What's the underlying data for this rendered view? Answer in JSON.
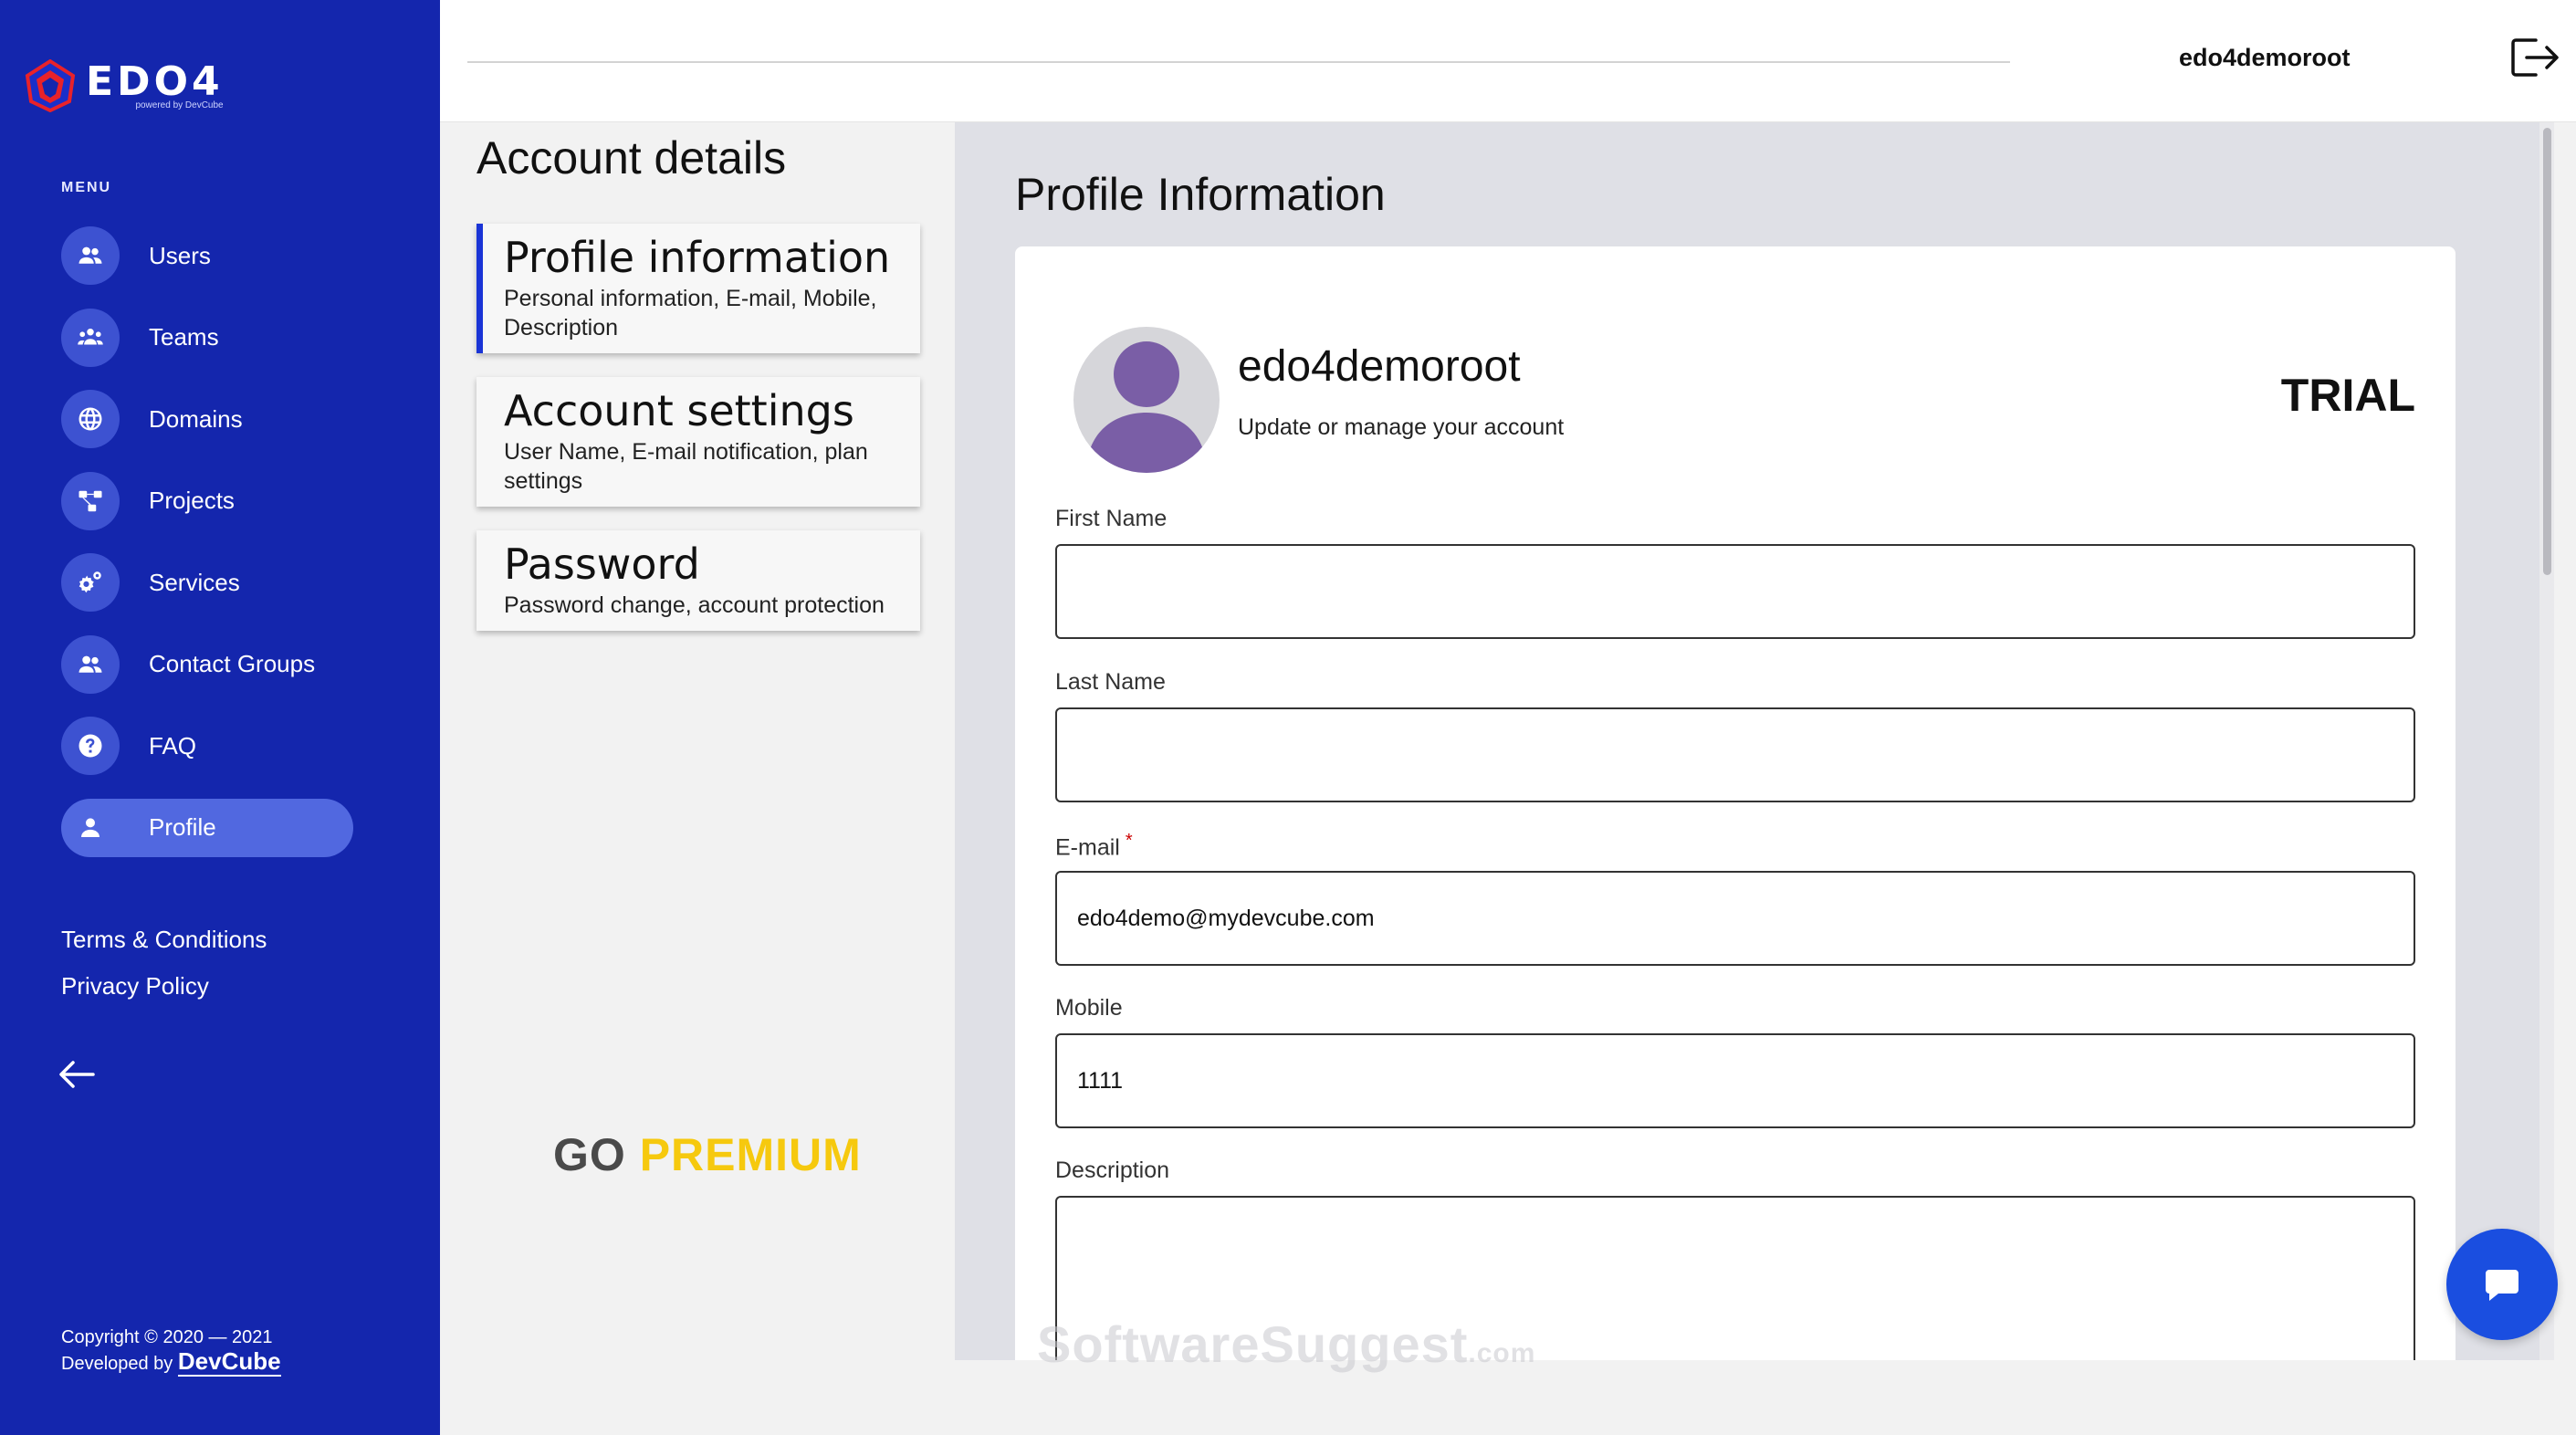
{
  "app": {
    "logo_text": "EDO4",
    "logo_subtitle": "powered by DevCube"
  },
  "sidebar": {
    "menu_label": "MENU",
    "items": [
      {
        "label": "Users",
        "icon": "users-icon"
      },
      {
        "label": "Teams",
        "icon": "teams-icon"
      },
      {
        "label": "Domains",
        "icon": "globe-icon"
      },
      {
        "label": "Projects",
        "icon": "projects-icon"
      },
      {
        "label": "Services",
        "icon": "gears-icon"
      },
      {
        "label": "Contact Groups",
        "icon": "contact-groups-icon"
      },
      {
        "label": "FAQ",
        "icon": "question-icon"
      },
      {
        "label": "Profile",
        "icon": "user-icon",
        "active": true
      }
    ],
    "links": {
      "terms": "Terms & Conditions",
      "privacy": "Privacy Policy"
    },
    "copyright": "Copyright © 2020 — 2021",
    "developed_by": "Developed by",
    "developer": "DevCube"
  },
  "topbar": {
    "username": "edo4demoroot"
  },
  "account": {
    "title": "Account details",
    "cards": [
      {
        "title": "Profile information",
        "desc": "Personal information, E-mail, Mobile, Description",
        "active": true
      },
      {
        "title": "Account settings",
        "desc": "User Name, E-mail notification, plan settings"
      },
      {
        "title": "Password",
        "desc": "Password change, account protection"
      }
    ],
    "go_premium": {
      "go": "GO",
      "premium": "PREMIUM"
    }
  },
  "profile": {
    "section_title": "Profile Information",
    "name": "edo4demoroot",
    "subtitle": "Update or manage your account",
    "plan": "TRIAL",
    "fields": {
      "first_name": {
        "label": "First Name",
        "value": ""
      },
      "last_name": {
        "label": "Last Name",
        "value": ""
      },
      "email": {
        "label": "E-mail",
        "required_mark": "*",
        "value": "edo4demo@mydevcube.com"
      },
      "mobile": {
        "label": "Mobile",
        "value": "1111"
      },
      "description": {
        "label": "Description",
        "value": ""
      }
    }
  },
  "watermark": {
    "text": "SoftwareSuggest",
    "suffix": ".com"
  },
  "colors": {
    "sidebar": "#1426ad",
    "active_item": "#5168e0",
    "accent": "#1a34d6",
    "premium": "#f6c90e",
    "chat_button": "#1a4ee0"
  }
}
